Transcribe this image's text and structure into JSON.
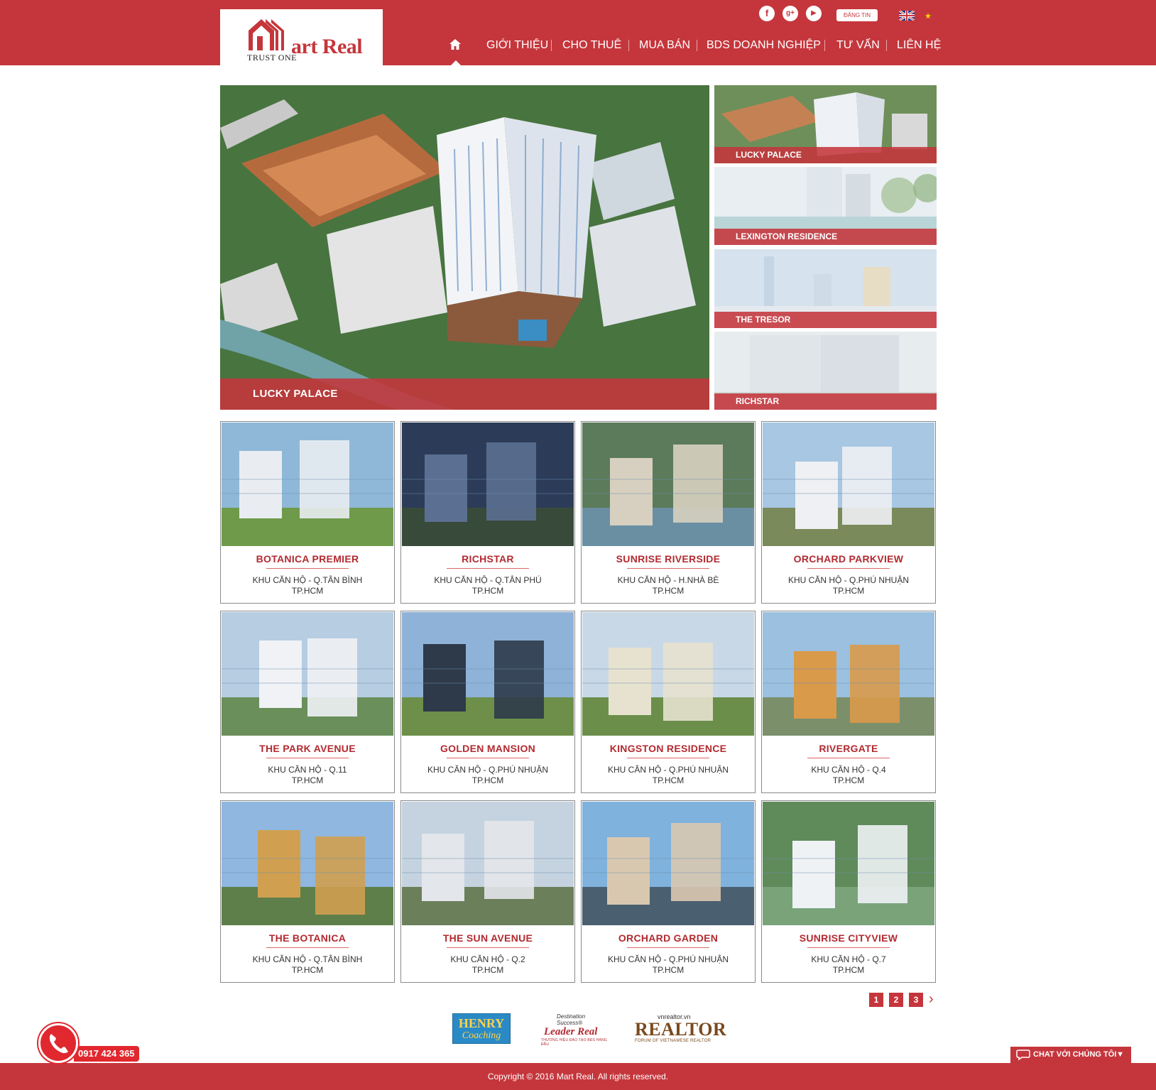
{
  "brand": {
    "logo_text": "art Real",
    "logo_tagline": "TRUST ONE",
    "primary_color": "#c5363c",
    "dark_red": "#b22a30"
  },
  "header": {
    "social": [
      {
        "icon": "facebook-icon",
        "glyph": "f"
      },
      {
        "icon": "google-plus-icon",
        "glyph": "g+"
      },
      {
        "icon": "youtube-icon",
        "glyph": "▶"
      }
    ],
    "post_button": "ĐĂNG TIN",
    "languages": [
      "English",
      "Tiếng Việt"
    ],
    "nav": [
      "GIỚI THIỆU",
      "CHO THUÊ",
      "MUA BÁN",
      "BDS DOANH NGHIỆP",
      "TƯ VẤN",
      "LIÊN HỆ"
    ]
  },
  "featured": {
    "main_caption": "LUCKY PALACE",
    "side": [
      "LUCKY PALACE",
      "LEXINGTON RESIDENCE",
      "THE TRESOR",
      "RICHSTAR"
    ]
  },
  "projects": [
    {
      "name": "BOTANICA PREMIER",
      "line1": "KHU CĂN HỘ - Q.TÂN BÌNH",
      "line2": "TP.HCM"
    },
    {
      "name": "RICHSTAR",
      "line1": "KHU CĂN HỘ - Q.TÂN PHÚ",
      "line2": "TP.HCM"
    },
    {
      "name": "SUNRISE RIVERSIDE",
      "line1": "KHU CĂN HỘ - H.NHÀ BÈ",
      "line2": "TP.HCM"
    },
    {
      "name": "ORCHARD PARKVIEW",
      "line1": "KHU CĂN HỘ - Q.PHÚ NHUẬN",
      "line2": "TP.HCM"
    },
    {
      "name": "THE PARK AVENUE",
      "line1": "KHU CĂN HỘ - Q.11",
      "line2": "TP.HCM"
    },
    {
      "name": "GOLDEN MANSION",
      "line1": "KHU CĂN HỘ - Q.PHÚ NHUẬN",
      "line2": "TP.HCM"
    },
    {
      "name": "KINGSTON RESIDENCE",
      "line1": "KHU CĂN HỘ - Q.PHÚ NHUẬN",
      "line2": "TP.HCM"
    },
    {
      "name": "RIVERGATE",
      "line1": "KHU CĂN HỘ - Q.4",
      "line2": "TP.HCM"
    },
    {
      "name": "THE BOTANICA",
      "line1": "KHU CĂN HỘ - Q.TÂN BÌNH",
      "line2": "TP.HCM"
    },
    {
      "name": "THE SUN AVENUE",
      "line1": "KHU CĂN HỘ - Q.2",
      "line2": "TP.HCM"
    },
    {
      "name": "ORCHARD GARDEN",
      "line1": "KHU CĂN HỘ - Q.PHÚ NHUẬN",
      "line2": "TP.HCM"
    },
    {
      "name": "SUNRISE CITYVIEW",
      "line1": "KHU CĂN HỘ - Q.7",
      "line2": "TP.HCM"
    }
  ],
  "pagination": {
    "pages": [
      "1",
      "2",
      "3"
    ],
    "next": "›"
  },
  "partners": {
    "henry": {
      "line1": "HENRY",
      "line2": "Coaching"
    },
    "leader": {
      "small": "Destination Success®",
      "main": "Leader Real",
      "sub": "THƯƠNG HIỆU ĐÀO TẠO BĐS HÀNG ĐẦU"
    },
    "realtor": {
      "small": "vnrealtor.vn",
      "main": "REALTOR",
      "sub": "FORUM OF VIETNAMESE REALTOR"
    }
  },
  "hotline": "0917 424 365",
  "chat_label": "CHAT VỚI CHÚNG TÔI",
  "footer": "Copyright © 2016 Mart Real. All rights reserved."
}
